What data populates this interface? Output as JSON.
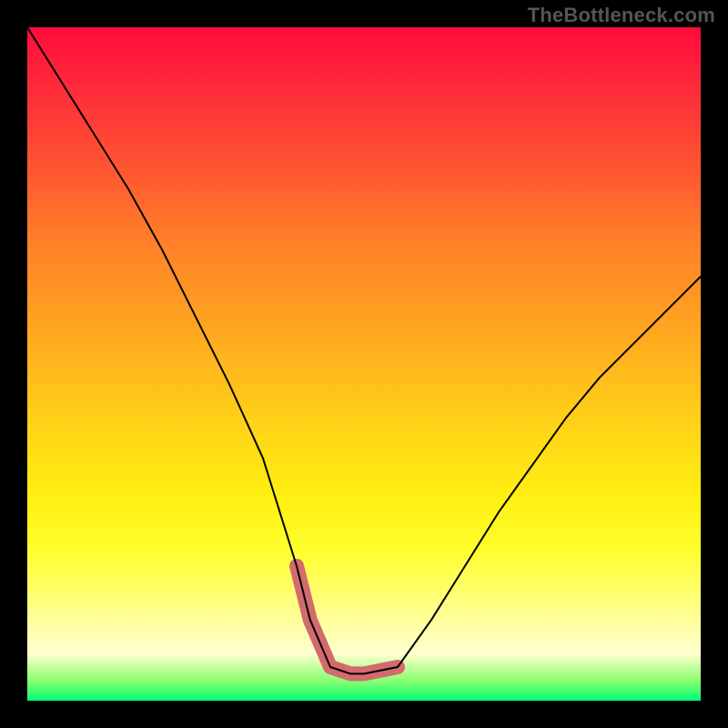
{
  "watermark": {
    "text": "TheBottleneck.com"
  },
  "colors": {
    "frame_bg": "#000000",
    "curve": "#000000",
    "highlight": "#d36a6e",
    "gradient_top": "#ff0b3b",
    "gradient_bottom": "#00ff77"
  },
  "chart_data": {
    "type": "line",
    "title": "",
    "xlabel": "",
    "ylabel": "",
    "xlim": [
      0,
      100
    ],
    "ylim": [
      0,
      100
    ],
    "grid": false,
    "series": [
      {
        "name": "bottleneck-curve",
        "x": [
          0,
          5,
          10,
          15,
          20,
          25,
          30,
          35,
          40,
          42,
          45,
          48,
          50,
          55,
          60,
          65,
          70,
          75,
          80,
          85,
          90,
          95,
          100
        ],
        "values": [
          100,
          92,
          84,
          76,
          67,
          57,
          47,
          36,
          20,
          12,
          5,
          4,
          4,
          5,
          12,
          20,
          28,
          35,
          42,
          48,
          53,
          58,
          63
        ]
      }
    ],
    "highlight_range_x": [
      39,
      56
    ],
    "background_gradient_stops": [
      {
        "pos": 0.0,
        "color": "#ff0b3b"
      },
      {
        "pos": 0.1,
        "color": "#ff2f3a"
      },
      {
        "pos": 0.22,
        "color": "#ff5a30"
      },
      {
        "pos": 0.32,
        "color": "#ff8028"
      },
      {
        "pos": 0.44,
        "color": "#ffa320"
      },
      {
        "pos": 0.58,
        "color": "#ffd018"
      },
      {
        "pos": 0.7,
        "color": "#fff010"
      },
      {
        "pos": 0.78,
        "color": "#ffff30"
      },
      {
        "pos": 0.86,
        "color": "#ffff85"
      },
      {
        "pos": 0.93,
        "color": "#ffffd0"
      },
      {
        "pos": 0.97,
        "color": "#8aff70"
      },
      {
        "pos": 1.0,
        "color": "#00ff77"
      }
    ]
  }
}
